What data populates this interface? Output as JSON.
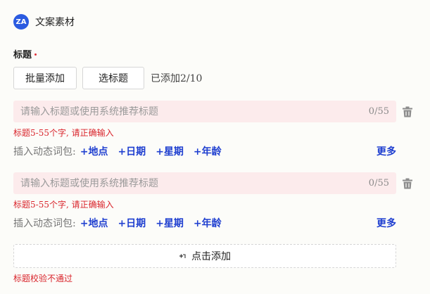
{
  "header": {
    "logo_text": "ZA",
    "title": "文案素材"
  },
  "field": {
    "label": "标题"
  },
  "actions": {
    "batch_add": "批量添加",
    "select_title": "选标题",
    "added_count": "已添加2/10"
  },
  "entries": [
    {
      "placeholder": "请输入标题或使用系统推荐标题",
      "value": "",
      "char_count": "0/55",
      "error": "标题5-55个字, 请正确输入",
      "keywords_label": "插入动态词包:",
      "keywords": [
        "+地点",
        "+日期",
        "+星期",
        "+年龄"
      ],
      "more": "更多"
    },
    {
      "placeholder": "请输入标题或使用系统推荐标题",
      "value": "",
      "char_count": "0/55",
      "error": "标题5-55个字, 请正确输入",
      "keywords_label": "插入动态词包:",
      "keywords": [
        "+地点",
        "+日期",
        "+星期",
        "+年龄"
      ],
      "more": "更多"
    }
  ],
  "add_box": {
    "label": "点击添加"
  },
  "validation": {
    "message": "标题校验不通过"
  },
  "colors": {
    "accent": "#1f3fd0",
    "error": "#d9252c",
    "input_bg": "#fcebec",
    "logo": "#2b5be0"
  },
  "icons": {
    "trash": "trash-icon",
    "add": "cursor-plus-icon",
    "logo": "brand-logo-icon"
  }
}
